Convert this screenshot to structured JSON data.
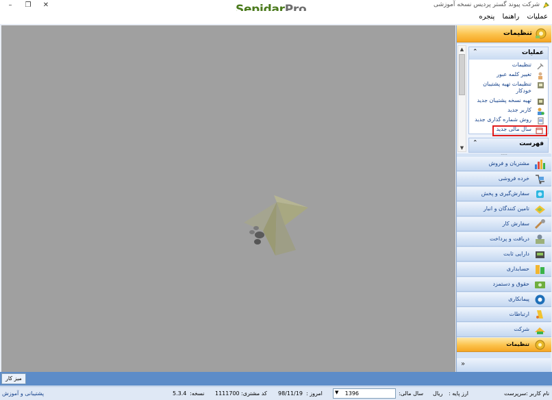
{
  "window": {
    "title": "شرکت پیوند گستر پردیس نسخه آموزشی",
    "logo_part1": "Sepidar",
    "logo_part2": "Pro",
    "minimize": "–",
    "restore": "❐",
    "close": "✕"
  },
  "menu": [
    "عملیات",
    "راهنما",
    "پنجره"
  ],
  "nav": {
    "header": "تنظیمات",
    "groups": {
      "operations": {
        "title": "عملیات",
        "items": [
          {
            "label": "تنظیمات",
            "icon": "settings-icon"
          },
          {
            "label": "تغییر کلمه عبور",
            "icon": "user-key-icon"
          },
          {
            "label": "تنظیمات تهیه پشتیبان خودکار",
            "icon": "auto-backup-icon"
          },
          {
            "label": "تهیه نسخه پشتیبان جدید",
            "icon": "backup-icon"
          },
          {
            "label": "کاربر جدید",
            "icon": "new-user-icon"
          },
          {
            "label": "روش شماره گذاری جدید",
            "icon": "numbering-icon"
          },
          {
            "label": "سال مالی جدید",
            "icon": "fiscal-year-icon"
          }
        ]
      },
      "list": {
        "title": "فهرست"
      }
    },
    "modules": [
      {
        "label": "مشتریان و فروش",
        "icon": "sales-chart-icon"
      },
      {
        "label": "خرده فروشی",
        "icon": "retail-icon"
      },
      {
        "label": "سفارش‌گیری و پخش",
        "icon": "distribution-icon"
      },
      {
        "label": "تامین کنندگان و انبار",
        "icon": "suppliers-icon"
      },
      {
        "label": "سفارش کار",
        "icon": "work-order-icon"
      },
      {
        "label": "دریافت و پرداخت",
        "icon": "payment-icon"
      },
      {
        "label": "دارایی ثابت",
        "icon": "fixed-assets-icon"
      },
      {
        "label": "حسابداری",
        "icon": "accounting-icon"
      },
      {
        "label": "حقوق و دستمزد",
        "icon": "payroll-icon"
      },
      {
        "label": "پیمانکاری",
        "icon": "contracting-icon"
      },
      {
        "label": "ارتباطات",
        "icon": "communications-icon"
      },
      {
        "label": "شرکت",
        "icon": "company-icon"
      },
      {
        "label": "تنظیمات",
        "icon": "settings-module-icon",
        "active": true
      }
    ]
  },
  "tabs": {
    "desk": "میز کار"
  },
  "status": {
    "user_label": "نام کاربر :",
    "user_value": "سرپرست",
    "base_currency_label": "ارز پایه :",
    "base_currency_value": "ریال",
    "fiscal_year_label": "سال مالی:",
    "fiscal_year_value": "1396",
    "today_label": "امروز :",
    "today_value": "98/11/19",
    "customer_code_label": "کد مشتری:",
    "customer_code_value": "1111700",
    "version_label": "نسخه:",
    "version_value": "5.3.4",
    "support_link": "پشتیبانی و آموزش"
  },
  "colors": {
    "accent_orange": "#f6a623",
    "nav_blue": "#c5d8f1",
    "tab_bar_blue": "#5d8cc8",
    "highlight_red": "#e01b1b",
    "logo_green": "#4a7a1c",
    "logo_gray": "#6d6d6d"
  }
}
